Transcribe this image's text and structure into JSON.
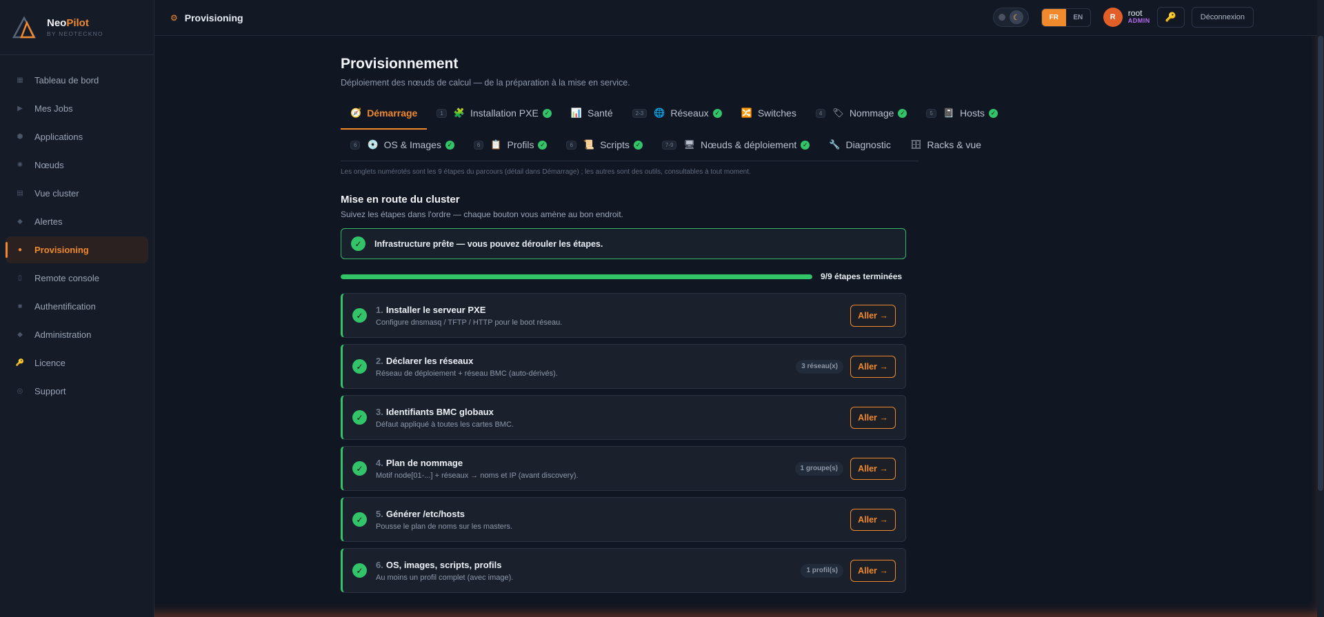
{
  "brand": {
    "name_a": "Neo",
    "name_b": "Pilot",
    "sub": "BY NEOTECKNO"
  },
  "sidebar": {
    "items": [
      {
        "label": "Tableau de bord",
        "icon": "dashboard-icon"
      },
      {
        "label": "Mes Jobs",
        "icon": "play-icon"
      },
      {
        "label": "Applications",
        "icon": "package-icon"
      },
      {
        "label": "Nœuds",
        "icon": "node-icon"
      },
      {
        "label": "Vue cluster",
        "icon": "grid-icon"
      },
      {
        "label": "Alertes",
        "icon": "diamond-icon"
      },
      {
        "label": "Provisioning",
        "icon": "provisioning-icon",
        "active": true
      },
      {
        "label": "Remote console",
        "icon": "console-icon"
      },
      {
        "label": "Authentification",
        "icon": "lock-icon"
      },
      {
        "label": "Administration",
        "icon": "admin-icon"
      },
      {
        "label": "Licence",
        "icon": "key-icon"
      },
      {
        "label": "Support",
        "icon": "lifebuoy-icon"
      }
    ]
  },
  "topbar": {
    "crumb": "Provisioning",
    "lang_fr": "FR",
    "lang_en": "EN",
    "avatar_letter": "R",
    "user_name": "root",
    "user_role": "ADMIN",
    "logout": "Déconnexion"
  },
  "page": {
    "title": "Provisionnement",
    "subtitle": "Déploiement des nœuds de calcul — de la préparation à la mise en service."
  },
  "tabs": {
    "row1": [
      {
        "label": "Démarrage",
        "num": "",
        "icon": "🧭",
        "check": false,
        "active": true
      },
      {
        "label": "Installation PXE",
        "num": "1",
        "icon": "🧩",
        "check": true
      },
      {
        "label": "Santé",
        "num": "",
        "icon": "📊",
        "check": false
      },
      {
        "label": "Réseaux",
        "num": "2-3",
        "icon": "🌐",
        "check": true
      },
      {
        "label": "Switches",
        "num": "",
        "icon": "🔀",
        "check": false
      },
      {
        "label": "Nommage",
        "num": "4",
        "icon": "🏷",
        "check": true
      },
      {
        "label": "Hosts",
        "num": "5",
        "icon": "📓",
        "check": true
      }
    ],
    "row2": [
      {
        "label": "OS & Images",
        "num": "6",
        "icon": "💿",
        "check": true
      },
      {
        "label": "Profils",
        "num": "6",
        "icon": "📋",
        "check": true
      },
      {
        "label": "Scripts",
        "num": "6",
        "icon": "📜",
        "check": true
      },
      {
        "label": "Nœuds & déploiement",
        "num": "7-9",
        "icon": "🖥",
        "check": true
      },
      {
        "label": "Diagnostic",
        "num": "",
        "icon": "🔧",
        "check": false
      },
      {
        "label": "Racks & vue",
        "num": "",
        "icon": "🗄",
        "check": false
      }
    ],
    "note": "Les onglets numérotés sont les 9 étapes du parcours (détail dans Démarrage) ; les autres sont des outils, consultables à tout moment."
  },
  "section": {
    "title": "Mise en route du cluster",
    "subtitle": "Suivez les étapes dans l'ordre — chaque bouton vous amène au bon endroit.",
    "banner": "Infrastructure prête — vous pouvez dérouler les étapes."
  },
  "progress": {
    "done": 9,
    "total": 9,
    "label": "9/9 étapes terminées"
  },
  "steps": [
    {
      "n": "1.",
      "title": "Installer le serveur PXE",
      "desc": "Configure dnsmasq / TFTP / HTTP pour le boot réseau.",
      "badge": "",
      "button": "Aller →"
    },
    {
      "n": "2.",
      "title": "Déclarer les réseaux",
      "desc": "Réseau de déploiement + réseau BMC (auto-dérivés).",
      "badge": "3 réseau(x)",
      "button": "Aller →"
    },
    {
      "n": "3.",
      "title": "Identifiants BMC globaux",
      "desc": "Défaut appliqué à toutes les cartes BMC.",
      "badge": "",
      "button": "Aller →"
    },
    {
      "n": "4.",
      "title": "Plan de nommage",
      "desc": "Motif node[01-...] + réseaux → noms et IP (avant discovery).",
      "badge": "1 groupe(s)",
      "button": "Aller →"
    },
    {
      "n": "5.",
      "title": "Générer /etc/hosts",
      "desc": "Pousse le plan de noms sur les masters.",
      "badge": "",
      "button": "Aller →"
    },
    {
      "n": "6.",
      "title": "OS, images, scripts, profils",
      "desc": "Au moins un profil complet (avec image).",
      "badge": "1 profil(s)",
      "button": "Aller →"
    }
  ],
  "colors": {
    "accent": "#f08a2c",
    "success": "#33c46a",
    "bg": "#111722"
  }
}
